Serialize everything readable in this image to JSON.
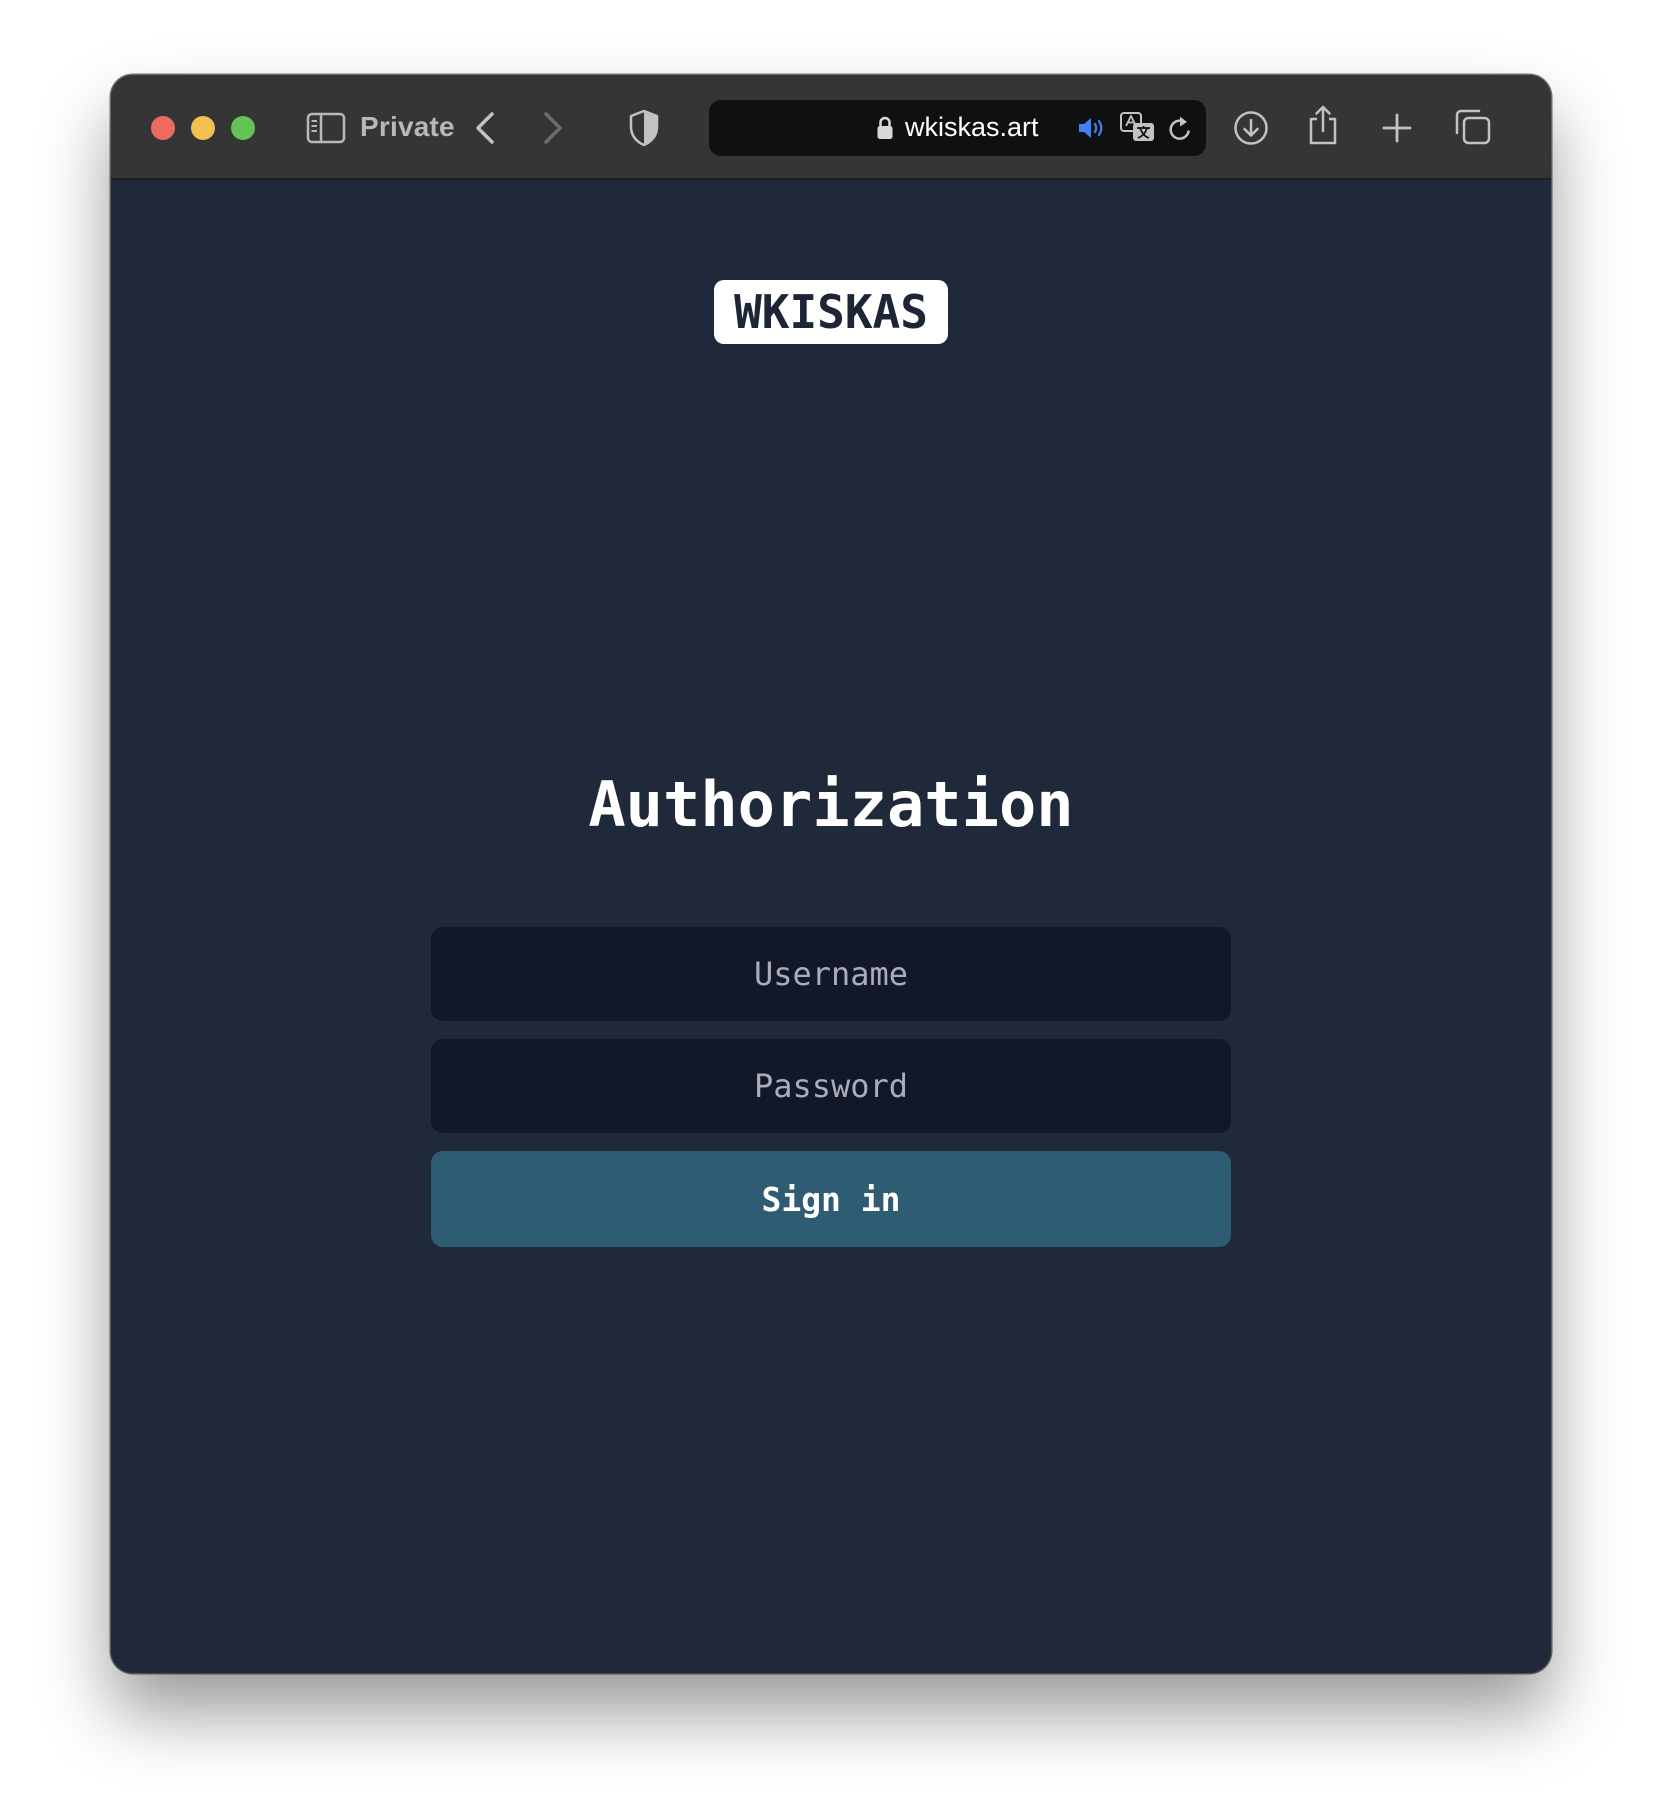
{
  "browser": {
    "private_label": "Private",
    "url": "wkiskas.art",
    "icons": {
      "sidebar": "sidebar-icon",
      "back": "chevron-left-icon",
      "forward": "chevron-right-icon",
      "privacy": "shield-icon",
      "lock": "lock-icon",
      "audio": "speaker-icon",
      "translate": "translate-icon",
      "reload": "reload-icon",
      "downloads": "download-icon",
      "share": "share-icon",
      "new_tab": "plus-icon",
      "tab_overview": "tabs-icon"
    },
    "colors": {
      "traffic_close": "#ed6a5e",
      "traffic_minimize": "#f4bf4f",
      "traffic_zoom": "#61c554",
      "audio_icon": "#3d82f6"
    }
  },
  "page": {
    "logo": "WKISKAS",
    "title": "Authorization",
    "username_placeholder": "Username",
    "password_placeholder": "Password",
    "signin_label": "Sign in",
    "colors": {
      "background": "#20293a",
      "input_background": "#12172a",
      "button_background": "#2e5c73"
    }
  }
}
